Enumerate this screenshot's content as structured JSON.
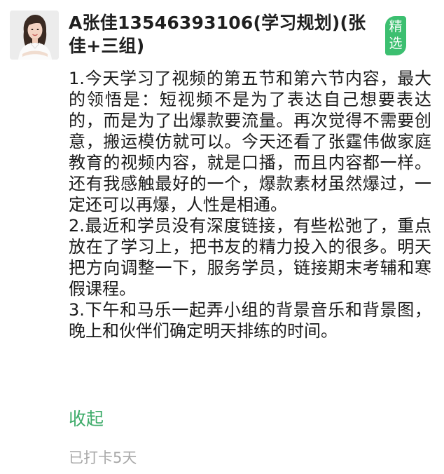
{
  "post": {
    "author": "A张佳13546393106(学习规划)(张佳+三组)",
    "badge": "精选",
    "paragraphs": [
      "1.今天学习了视频的第五节和第六节内容，最大的领悟是：短视频不是为了表达自己想要表达的，而是为了出爆款要流量。再次觉得不需要创意，搬运模仿就可以。今天还看了张霆伟做家庭教育的视频内容，就是口播，而且内容都一样。还有我感触最好的一个，爆款素材虽然爆过，一定还可以再爆，人性是相通。",
      "2.最近和学员没有深度链接，有些松弛了，重点放在了学习上，把书友的精力投入的很多。明天把方向调整一下，服务学员，链接期末考辅和寒假课程。",
      "3.下午和马乐一起弄小组的背景音乐和背景图，晚上和伙伴们确定明天排练的时间。"
    ],
    "collapse_label": "收起",
    "checkin_status": "已打卡5天"
  },
  "colors": {
    "accent_green": "#3dab69",
    "badge_green": "#3cbf70",
    "muted_gray": "#a8a8a8"
  },
  "icons": {
    "avatar": "author-avatar-photo"
  }
}
